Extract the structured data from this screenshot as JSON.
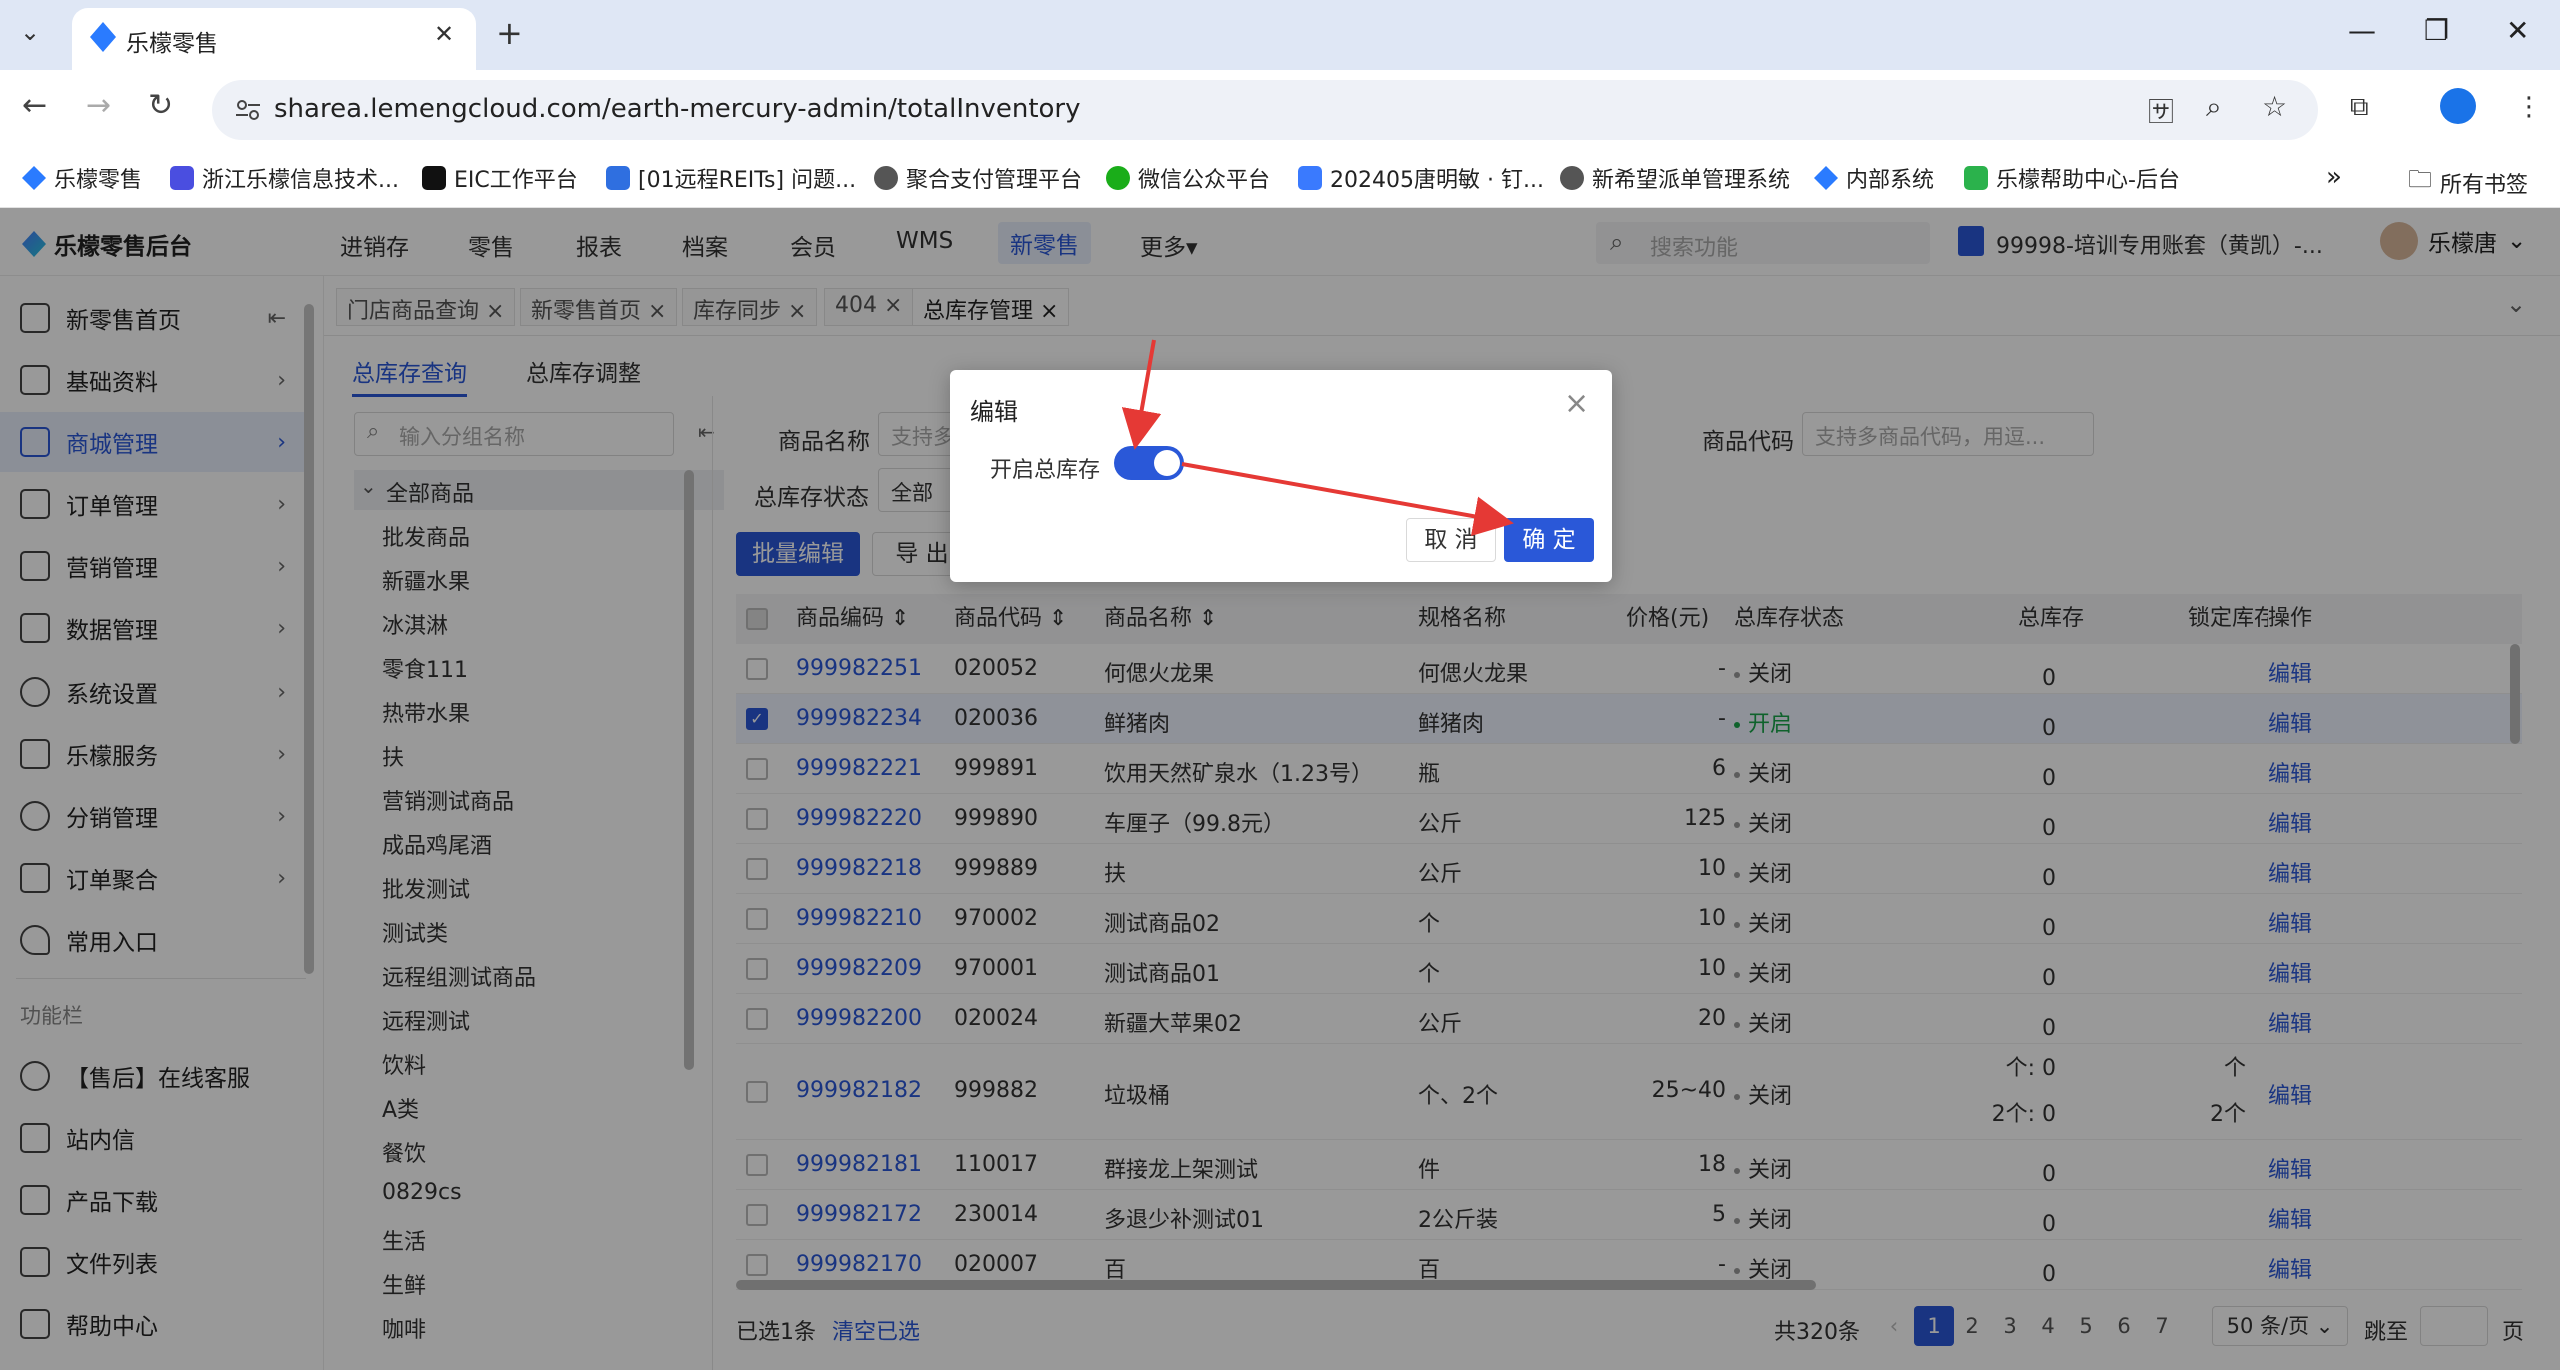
{
  "browser": {
    "tab_title": "乐檬零售",
    "url": "sharea.lemengcloud.com/earth-mercury-admin/totalInventory",
    "bookmarks": [
      "乐檬零售",
      "浙江乐檬信息技术...",
      "EIC工作平台",
      "[01远程REITs] 问题...",
      "聚合支付管理平台",
      "微信公众平台",
      "202405唐明敏 · 钉...",
      "新希望派单管理系统",
      "内部系统",
      "乐檬帮助中心-后台"
    ],
    "all_bookmarks": "所有书签",
    "more_bookmarks": "»"
  },
  "app": {
    "brand": "乐檬零售后台",
    "nav": [
      "进销存",
      "零售",
      "报表",
      "档案",
      "会员",
      "WMS",
      "新零售",
      "更多▾"
    ],
    "active_nav": "新零售",
    "search_placeholder": "搜索功能",
    "account": "99998-培训专用账套（黄凯）-...",
    "user": "乐檬唐"
  },
  "sidebar": {
    "items": [
      {
        "label": "新零售首页",
        "icon": "home-icon"
      },
      {
        "label": "基础资料",
        "icon": "grid-icon"
      },
      {
        "label": "商城管理",
        "icon": "shop-icon"
      },
      {
        "label": "订单管理",
        "icon": "order-icon"
      },
      {
        "label": "营销管理",
        "icon": "marketing-icon"
      },
      {
        "label": "数据管理",
        "icon": "chart-icon"
      },
      {
        "label": "系统设置",
        "icon": "gear-icon"
      },
      {
        "label": "乐檬服务",
        "icon": "service-icon"
      },
      {
        "label": "分销管理",
        "icon": "distribution-icon"
      },
      {
        "label": "订单聚合",
        "icon": "aggregate-icon"
      },
      {
        "label": "常用入口",
        "icon": "heart-icon"
      }
    ],
    "section": "功能栏",
    "func_items": [
      "【售后】在线客服",
      "站内信",
      "产品下载",
      "文件列表",
      "帮助中心"
    ]
  },
  "pagetabs": [
    "门店商品查询 ×",
    "新零售首页 ×",
    "库存同步 ×",
    "404 ×",
    "总库存管理 ×"
  ],
  "subtabs": [
    "总库存查询",
    "总库存调整"
  ],
  "tree": {
    "search_placeholder": "输入分组名称",
    "root": "全部商品",
    "children": [
      "批发商品",
      "新疆水果",
      "冰淇淋",
      "零食111",
      "热带水果",
      "扶",
      "营销测试商品",
      "成品鸡尾酒",
      "批发测试",
      "测试类",
      "远程组测试商品",
      "远程测试",
      "饮料",
      "A类",
      "餐饮",
      "0829cs",
      "生活",
      "生鲜",
      "咖啡"
    ]
  },
  "filters": {
    "name_label": "商品名称",
    "name_placeholder": "支持多",
    "code_label": "商品代码",
    "code_placeholder": "支持多商品代码，用逗...",
    "status_label": "总库存状态",
    "status_value": "全部",
    "batch_edit": "批量编辑",
    "export": "导 出"
  },
  "table": {
    "headers": [
      "商品编码 ⇕",
      "商品代码 ⇕",
      "商品名称 ⇕",
      "规格名称",
      "价格(元)",
      "总库存状态",
      "总库存",
      "锁定库存",
      "操作"
    ],
    "rows": [
      {
        "code": "999982251",
        "pcode": "020052",
        "name": "何偲火龙果",
        "spec": "何偲火龙果",
        "price": "-",
        "status": "关闭",
        "stock": "0",
        "edit": "编辑",
        "checked": false
      },
      {
        "code": "999982234",
        "pcode": "020036",
        "name": "鲜猪肉",
        "spec": "鲜猪肉",
        "price": "-",
        "status": "开启",
        "stock": "0",
        "edit": "编辑",
        "checked": true
      },
      {
        "code": "999982221",
        "pcode": "999891",
        "name": "饮用天然矿泉水（1.23号）",
        "spec": "瓶",
        "price": "6",
        "status": "关闭",
        "stock": "0",
        "edit": "编辑",
        "checked": false
      },
      {
        "code": "999982220",
        "pcode": "999890",
        "name": "车厘子（99.8元）",
        "spec": "公斤",
        "price": "125",
        "status": "关闭",
        "stock": "0",
        "edit": "编辑",
        "checked": false
      },
      {
        "code": "999982218",
        "pcode": "999889",
        "name": "扶",
        "spec": "公斤",
        "price": "10",
        "status": "关闭",
        "stock": "0",
        "edit": "编辑",
        "checked": false
      },
      {
        "code": "999982210",
        "pcode": "970002",
        "name": "测试商品02",
        "spec": "个",
        "price": "10",
        "status": "关闭",
        "stock": "0",
        "edit": "编辑",
        "checked": false
      },
      {
        "code": "999982209",
        "pcode": "970001",
        "name": "测试商品01",
        "spec": "个",
        "price": "10",
        "status": "关闭",
        "stock": "0",
        "edit": "编辑",
        "checked": false
      },
      {
        "code": "999982200",
        "pcode": "020024",
        "name": "新疆大苹果02",
        "spec": "公斤",
        "price": "20",
        "status": "关闭",
        "stock": "0",
        "edit": "编辑",
        "checked": false
      },
      {
        "code": "999982182",
        "pcode": "999882",
        "name": "垃圾桶",
        "spec": "个、2个",
        "price": "25~40",
        "status": "关闭",
        "stock": "个: 0\n2个: 0",
        "lock": "个\n2个",
        "edit": "编辑",
        "checked": false,
        "tall": true
      },
      {
        "code": "999982181",
        "pcode": "110017",
        "name": "群接龙上架测试",
        "spec": "件",
        "price": "18",
        "status": "关闭",
        "stock": "0",
        "edit": "编辑",
        "checked": false
      },
      {
        "code": "999982172",
        "pcode": "230014",
        "name": "多退少补测试01",
        "spec": "2公斤装",
        "price": "5",
        "status": "关闭",
        "stock": "0",
        "edit": "编辑",
        "checked": false
      },
      {
        "code": "999982170",
        "pcode": "020007",
        "name": "百",
        "spec": "百",
        "price": "-",
        "status": "关闭",
        "stock": "0",
        "edit": "编辑",
        "checked": false
      }
    ]
  },
  "footer": {
    "selected": "已选1条",
    "clear": "清空已选",
    "total": "共320条",
    "pages": [
      "1",
      "2",
      "3",
      "4",
      "5",
      "6",
      "7"
    ],
    "current_page": "1",
    "page_size": "50 条/页",
    "jump": "跳至",
    "page_unit": "页"
  },
  "dialog": {
    "title": "编辑",
    "label": "开启总库存",
    "toggle_on": true,
    "cancel": "取 消",
    "ok": "确 定"
  },
  "colors": {
    "primary": "#2a58d8",
    "annotation": "#e53935"
  }
}
